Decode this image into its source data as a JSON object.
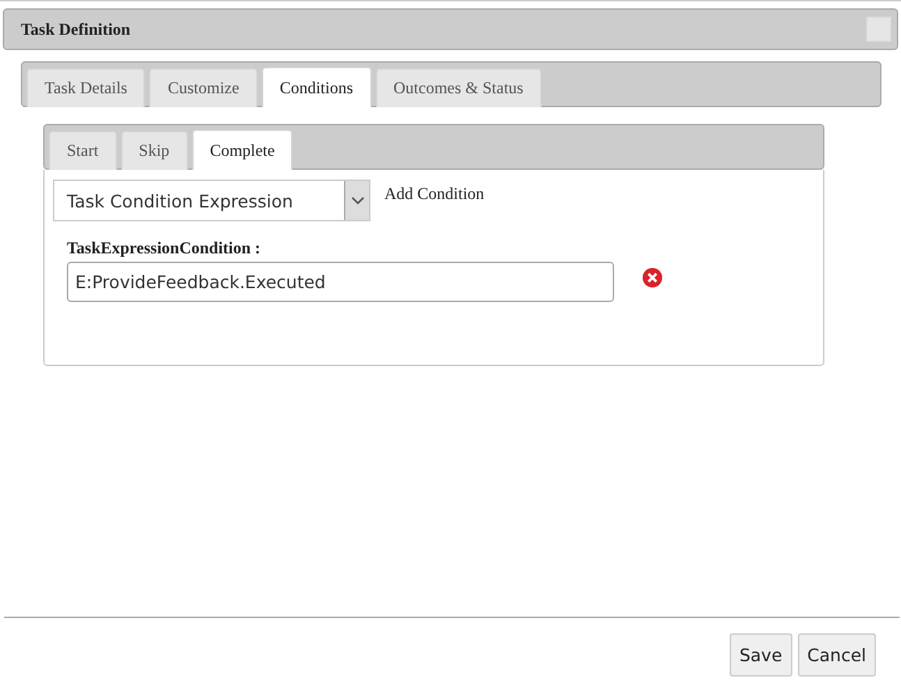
{
  "window": {
    "title": "Task Definition"
  },
  "tabs": [
    {
      "label": "Task Details",
      "selected": false
    },
    {
      "label": "Customize",
      "selected": false
    },
    {
      "label": "Conditions",
      "selected": true
    },
    {
      "label": "Outcomes & Status",
      "selected": false
    }
  ],
  "subtabs": [
    {
      "label": "Start",
      "selected": false
    },
    {
      "label": "Skip",
      "selected": false
    },
    {
      "label": "Complete",
      "selected": true
    }
  ],
  "condition_type": {
    "value": "Task Condition Expression"
  },
  "add_condition": "Add Condition",
  "field": {
    "label": "TaskExpressionCondition :",
    "value": "E:ProvideFeedback.Executed"
  },
  "buttons": [
    "Save",
    "Cancel"
  ]
}
